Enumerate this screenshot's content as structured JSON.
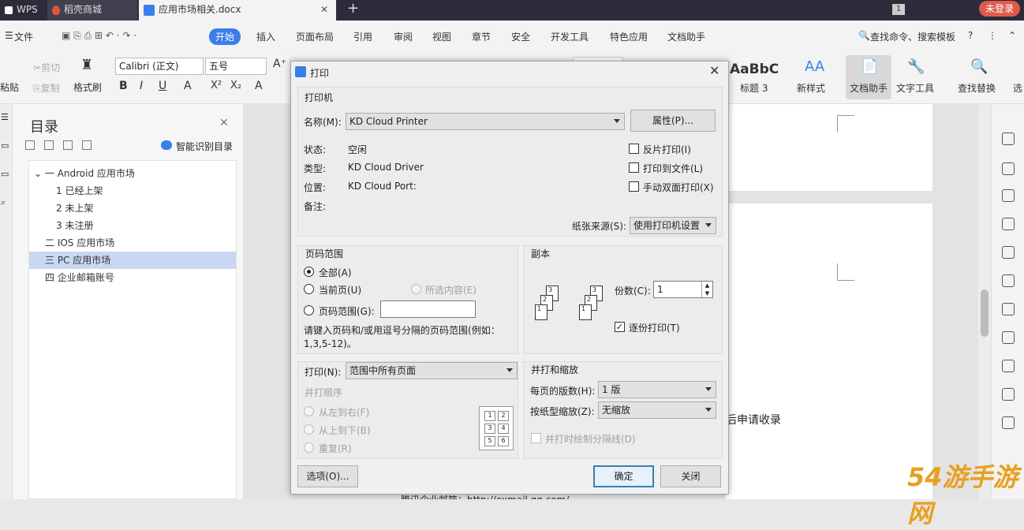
{
  "tabs": {
    "wps": "WPS",
    "daoke": "稻壳商城",
    "doc": "应用市场相关.docx"
  },
  "login_label": "未登录",
  "menu": {
    "file": "文件",
    "start": "开始",
    "insert": "插入",
    "layout": "页面布局",
    "ref": "引用",
    "review": "审阅",
    "view": "视图",
    "chapter": "章节",
    "security": "安全",
    "dev": "开发工具",
    "special": "特色应用",
    "assistant": "文档助手",
    "search": "查找命令、搜索模板"
  },
  "ribbon": {
    "paste": "粘贴",
    "cut": "剪切",
    "copy": "复制",
    "format_painter": "格式刷",
    "font": "Calibri (正文)",
    "size": "五号",
    "style_sample": "AaBbC",
    "style_name": "标题 3",
    "new_style": "新样式",
    "doc_assistant": "文档助手",
    "text_tools": "文字工具",
    "find_replace": "查找替换",
    "more": "选"
  },
  "toc": {
    "title": "目录",
    "smart": "智能识别目录",
    "items": [
      "一 Android 应用市场",
      "1 已经上架",
      "2 未上架",
      "3 未注册",
      "二 IOS 应用市场",
      "三 PC 应用市场",
      "四 企业邮箱账号"
    ]
  },
  "doc_text": {
    "line1": "后申请收录",
    "line2": "腾讯企业邮箱：http://exmail.qq.com/..."
  },
  "watermark": "54游手游网",
  "dialog": {
    "title": "打印",
    "printer_group": "打印机",
    "name_label": "名称(M):",
    "printer_name": "KD Cloud Printer",
    "properties_btn": "属性(P)...",
    "status_label": "状态:",
    "status_value": "空闲",
    "type_label": "类型:",
    "type_value": "KD Cloud Driver",
    "location_label": "位置:",
    "location_value": "KD Cloud Port:",
    "comment_label": "备注:",
    "reverse_print": "反片打印(I)",
    "print_to_file": "打印到文件(L)",
    "manual_duplex": "手动双面打印(X)",
    "paper_source_label": "纸张来源(S):",
    "paper_source_value": "使用打印机设置",
    "range_group": "页码范围",
    "range_all": "全部(A)",
    "range_current": "当前页(U)",
    "range_selection": "所选内容(E)",
    "range_pages": "页码范围(G):",
    "range_hint": "请键入页码和/或用逗号分隔的页码范围(例如：1,3,5-12)。",
    "copies_group": "副本",
    "copies_label": "份数(C):",
    "copies_value": "1",
    "collate": "逐份打印(T)",
    "print_label": "打印(N):",
    "print_value": "范围中所有页面",
    "order_group": "并打顺序",
    "order_lr": "从左到右(F)",
    "order_tb": "从上到下(B)",
    "order_repeat": "重复(R)",
    "zoom_group": "并打和缩放",
    "pages_per_sheet_label": "每页的版数(H):",
    "pages_per_sheet_value": "1 版",
    "scale_label": "按纸型缩放(Z):",
    "scale_value": "无缩放",
    "draw_lines": "并打时绘制分隔线(D)",
    "options_btn": "选项(O)...",
    "ok_btn": "确定",
    "close_btn": "关闭"
  }
}
